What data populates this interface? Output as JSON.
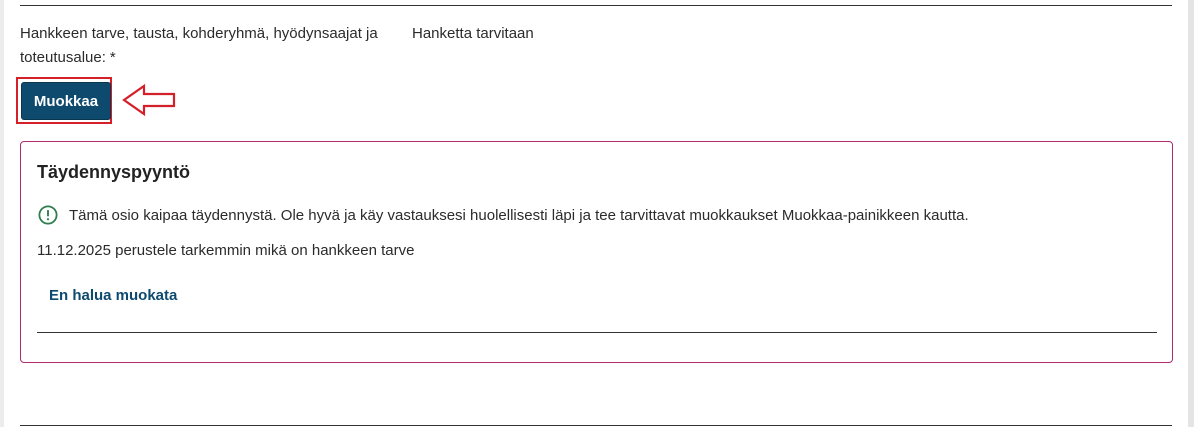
{
  "field": {
    "label": "Hankkeen tarve, tausta, kohderyhmä, hyödynsaajat ja toteutusalue:",
    "required_marker": "*",
    "value": "Hanketta tarvitaan"
  },
  "edit_button": {
    "label": "Muokkaa"
  },
  "annotation": {
    "highlight_color": "#d5202a",
    "arrow_icon": "left-arrow-icon"
  },
  "completion_request": {
    "title": "Täydennyspyyntö",
    "info_icon": "exclamation-circle-icon",
    "info_text": "Tämä osio kaipaa täydennystä. Ole hyvä ja käy vastauksesi huolellisesti läpi ja tee tarvittavat muokkaukset Muokkaa-painikkeen kautta.",
    "request_text": "11.12.2025 perustele tarkemmin mikä on hankkeen tarve",
    "decline_link": "En halua muokata",
    "border_color": "#b02a6e"
  },
  "colors": {
    "primary": "#0d4a6e",
    "info_icon": "#2e7d4f"
  }
}
